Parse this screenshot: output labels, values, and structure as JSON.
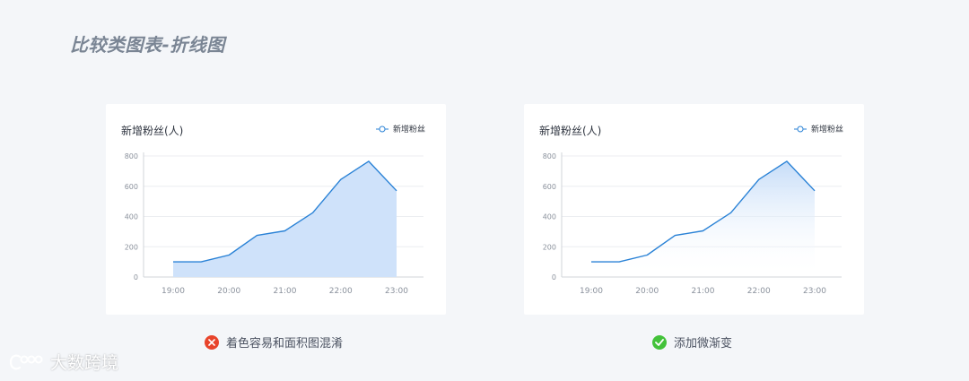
{
  "page": {
    "title": "比较类图表-折线图"
  },
  "colors": {
    "line": "#2a82d6",
    "area_solid": "#cfe2fa",
    "area_gradient_top": "#c5dcf8",
    "bad": "#e8442b",
    "good": "#43c23a"
  },
  "charts": [
    {
      "card_title": "新增粉丝(人)",
      "legend_label": "新增粉丝",
      "caption": "着色容易和面积图混淆",
      "status": "bad",
      "status_icon": "x-icon",
      "fill": "solid"
    },
    {
      "card_title": "新增粉丝(人)",
      "legend_label": "新增粉丝",
      "caption": "添加微渐变",
      "status": "good",
      "status_icon": "check-icon",
      "fill": "gradient"
    }
  ],
  "chart_data": [
    {
      "type": "area",
      "title": "新增粉丝(人)",
      "x_tick_labels": [
        "19:00",
        "20:00",
        "21:00",
        "22:00",
        "23:00"
      ],
      "y_ticks": [
        0,
        200,
        400,
        600,
        800
      ],
      "ylim": [
        0,
        800
      ],
      "xlim": [
        "19:00",
        "23:00"
      ],
      "grid": true,
      "legend_position": "top-right",
      "series": [
        {
          "name": "新增粉丝",
          "x": [
            "19:00",
            "19:30",
            "20:00",
            "20:30",
            "21:00",
            "21:30",
            "22:00",
            "22:30",
            "23:00"
          ],
          "values": [
            100,
            100,
            145,
            275,
            305,
            425,
            645,
            765,
            570
          ]
        }
      ],
      "area_fill": "solid"
    },
    {
      "type": "area",
      "title": "新增粉丝(人)",
      "x_tick_labels": [
        "19:00",
        "20:00",
        "21:00",
        "22:00",
        "23:00"
      ],
      "y_ticks": [
        0,
        200,
        400,
        600,
        800
      ],
      "ylim": [
        0,
        800
      ],
      "xlim": [
        "19:00",
        "23:00"
      ],
      "grid": true,
      "legend_position": "top-right",
      "series": [
        {
          "name": "新增粉丝",
          "x": [
            "19:00",
            "19:30",
            "20:00",
            "20:30",
            "21:00",
            "21:30",
            "22:00",
            "22:30",
            "23:00"
          ],
          "values": [
            100,
            100,
            145,
            275,
            305,
            425,
            645,
            765,
            570
          ]
        }
      ],
      "area_fill": "gradient"
    }
  ],
  "watermark": {
    "text": "大数跨境"
  }
}
